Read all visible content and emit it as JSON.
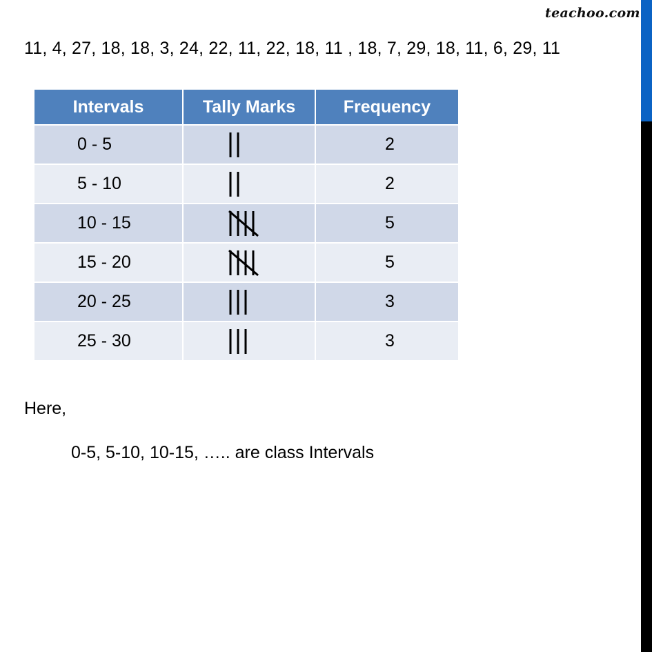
{
  "watermark": "teachoo.com",
  "data_line": "11, 4, 27, 18, 18, 3, 24, 22, 11, 22, 18, 11 , 18, 7, 29, 18, 11, 6, 29, 11",
  "table": {
    "headers": [
      "Intervals",
      "Tally Marks",
      "Frequency"
    ],
    "header_color": "#4f81bd",
    "row_colors": [
      "#d0d8e8",
      "#e9edf4"
    ],
    "rows": [
      {
        "interval": "0 - 5",
        "tally": 2,
        "frequency": "2"
      },
      {
        "interval": "5 - 10",
        "tally": 2,
        "frequency": "2"
      },
      {
        "interval": "10 - 15",
        "tally": 5,
        "frequency": "5"
      },
      {
        "interval": "15 - 20",
        "tally": 5,
        "frequency": "5"
      },
      {
        "interval": "20 - 25",
        "tally": 3,
        "frequency": "3"
      },
      {
        "interval": "25 - 30",
        "tally": 3,
        "frequency": "3"
      }
    ]
  },
  "here_label": "Here,",
  "explanation": "0-5, 5-10, 10-15, ….. are class Intervals",
  "scrollbar": {
    "thumb_color": "#0b63c4",
    "track_color": "#000000"
  }
}
